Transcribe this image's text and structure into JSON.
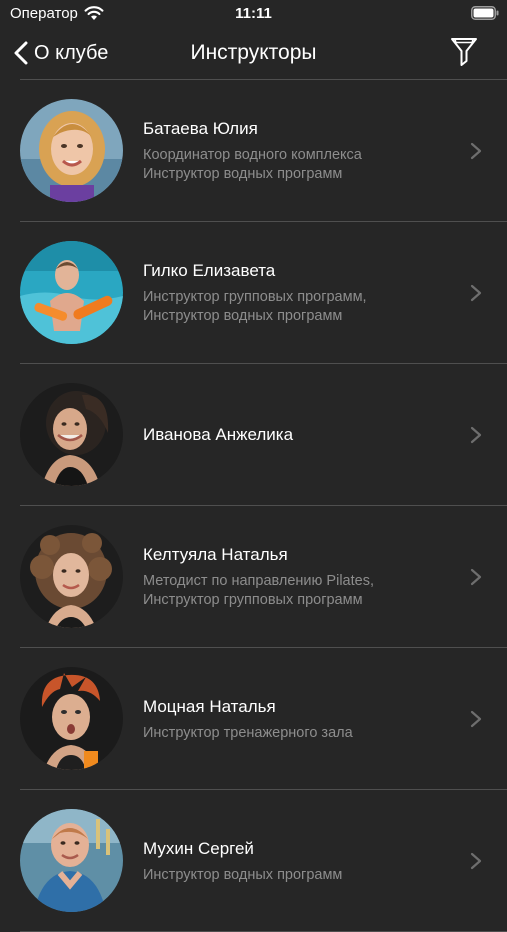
{
  "status_bar": {
    "carrier": "Оператор",
    "time": "11:11",
    "icons": [
      "wifi-icon",
      "battery-icon"
    ]
  },
  "nav": {
    "back_label": "О клубе",
    "title": "Инструкторы",
    "icons": [
      "chevron-left-icon",
      "filter-icon"
    ]
  },
  "colors": {
    "background": "#262626",
    "text_primary": "#ffffff",
    "text_secondary": "#8d8d8d",
    "divider": "#4f4f4f"
  },
  "instructors": [
    {
      "name": "Батаева Юлия",
      "roles": [
        "Координатор водного комплекса",
        "Инструктор водных программ"
      ]
    },
    {
      "name": "Гилко Елизавета",
      "roles": [
        "Инструктор групповых программ,",
        "Инструктор водных программ"
      ]
    },
    {
      "name": "Иванова Анжелика",
      "roles": []
    },
    {
      "name": "Келтуяла Наталья",
      "roles": [
        "Методист по  направлению Pilates,",
        "Инструктор групповых программ"
      ]
    },
    {
      "name": "Моцная Наталья",
      "roles": [
        "Инструктор тренажерного зала"
      ]
    },
    {
      "name": "Мухин Сергей",
      "roles": [
        "Инструктор водных программ"
      ]
    }
  ]
}
